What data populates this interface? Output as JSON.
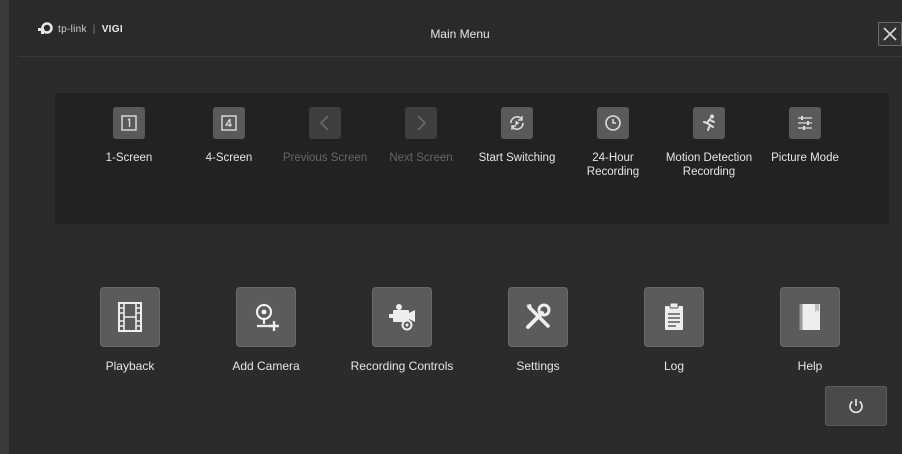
{
  "header": {
    "brand_name": "tp-link",
    "brand_product": "VIGI",
    "title": "Main Menu"
  },
  "top_menu": [
    {
      "label": "1-Screen",
      "icon": "one-screen-icon",
      "enabled": true
    },
    {
      "label": "4-Screen",
      "icon": "four-screen-icon",
      "enabled": true
    },
    {
      "label": "Previous Screen",
      "icon": "chevron-left-icon",
      "enabled": false
    },
    {
      "label": "Next Screen",
      "icon": "chevron-right-icon",
      "enabled": false
    },
    {
      "label": "Start Switching",
      "icon": "switch-cycle-icon",
      "enabled": true
    },
    {
      "label": "24-Hour Recording",
      "icon": "clock-icon",
      "enabled": true
    },
    {
      "label": "Motion Detection Recording",
      "icon": "running-person-icon",
      "enabled": true
    },
    {
      "label": "Picture Mode",
      "icon": "sliders-icon",
      "enabled": true
    }
  ],
  "main_menu": [
    {
      "label": "Playback",
      "icon": "film-icon"
    },
    {
      "label": "Add Camera",
      "icon": "add-camera-icon"
    },
    {
      "label": "Recording Controls",
      "icon": "camera-settings-icon"
    },
    {
      "label": "Settings",
      "icon": "tools-icon"
    },
    {
      "label": "Log",
      "icon": "clipboard-icon"
    },
    {
      "label": "Help",
      "icon": "book-icon"
    }
  ],
  "colors": {
    "background": "#2b2b2b",
    "panel": "#222222",
    "icon_tile": "#5a5a5a",
    "text": "#e6e6e6",
    "disabled_text": "#666666"
  }
}
